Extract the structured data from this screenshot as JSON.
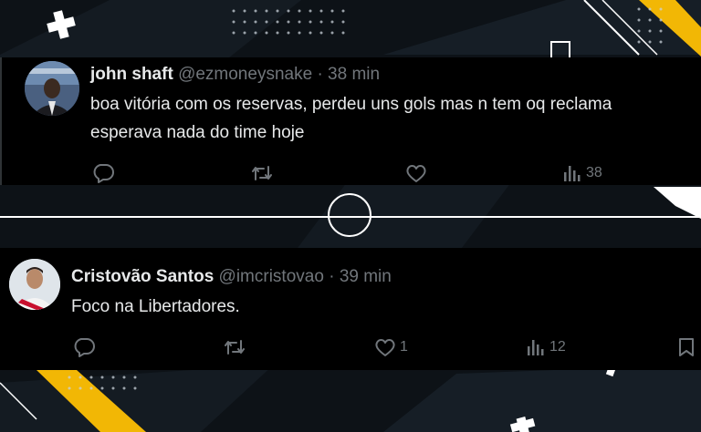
{
  "colors": {
    "accent_yellow": "#f2b705",
    "background": "#0d1217",
    "tweet_bg": "#000000",
    "text_primary": "#e7e9ea",
    "text_secondary": "#71767b"
  },
  "tweets": [
    {
      "name": "john shaft",
      "handle": "@ezmoneysnake",
      "separator": "·",
      "time": "38 min",
      "lines": [
        "boa vitória com os reservas, perdeu uns gols mas n tem oq reclama",
        "esperava nada do time hoje"
      ],
      "actions": {
        "reply": {
          "icon": "reply-icon",
          "count": ""
        },
        "retweet": {
          "icon": "retweet-icon",
          "count": ""
        },
        "like": {
          "icon": "heart-icon",
          "count": ""
        },
        "views": {
          "icon": "views-icon",
          "count": "38"
        }
      }
    },
    {
      "name": "Cristovão Santos",
      "handle": "@imcristovao",
      "separator": "·",
      "time": "39 min",
      "lines": [
        "Foco na Libertadores."
      ],
      "actions": {
        "reply": {
          "icon": "reply-icon",
          "count": ""
        },
        "retweet": {
          "icon": "retweet-icon",
          "count": ""
        },
        "like": {
          "icon": "heart-icon",
          "count": "1"
        },
        "views": {
          "icon": "views-icon",
          "count": "12"
        },
        "bookmark": {
          "icon": "bookmark-icon",
          "count": ""
        }
      }
    }
  ]
}
